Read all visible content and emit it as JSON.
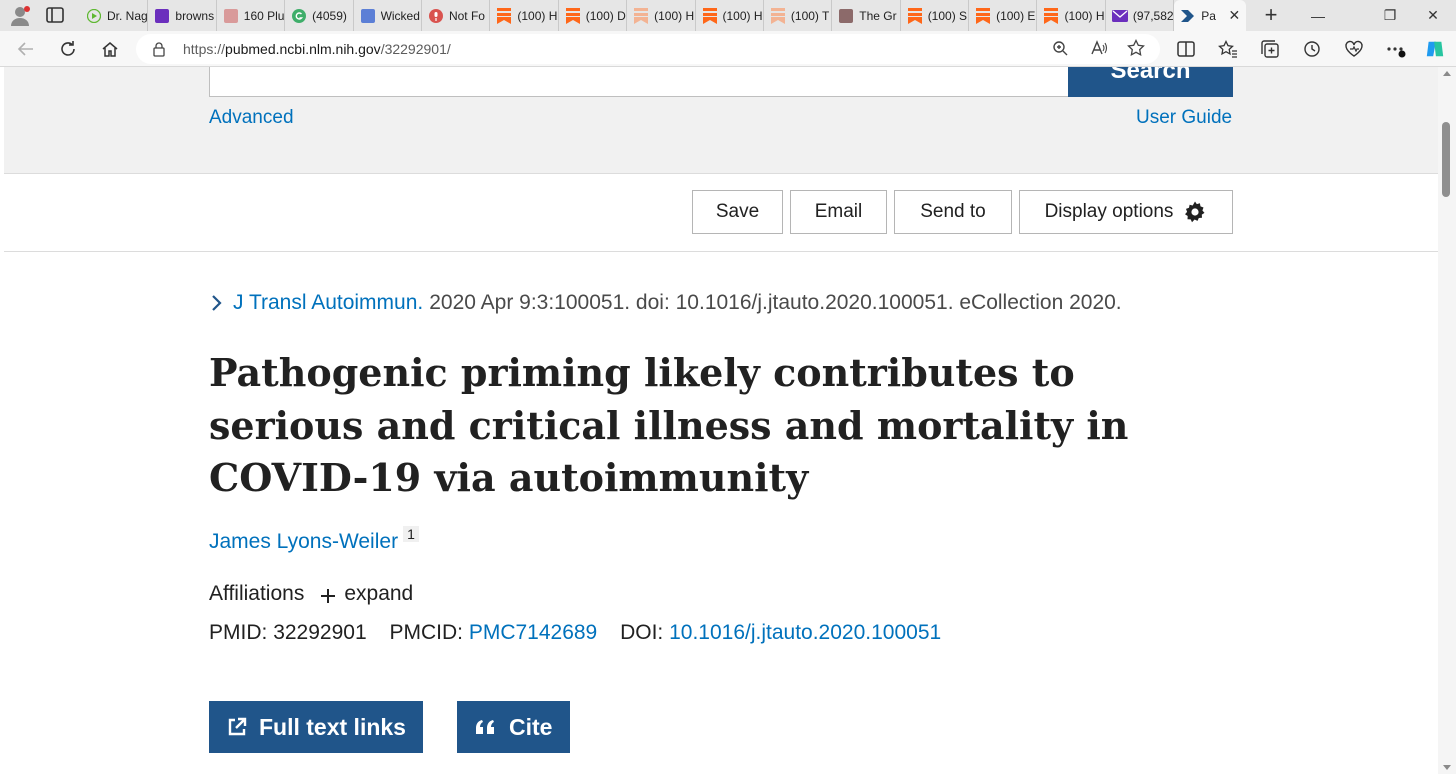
{
  "browser": {
    "tabs": [
      {
        "title": "Dr. Nag",
        "icon": "play-icon",
        "color": "#5fb832"
      },
      {
        "title": "browns",
        "icon": "yahoo-icon",
        "color": "#6b2fbd"
      },
      {
        "title": "160 Plu",
        "icon": "bi-icon",
        "color": "#d99a9a"
      },
      {
        "title": "(4059)",
        "icon": "grammarly-icon",
        "color": "#3fae6a"
      },
      {
        "title": "Wicked",
        "icon": "page-icon",
        "color": "#5c7fd6"
      },
      {
        "title": "Not Fo",
        "icon": "podcast-icon",
        "color": "#d9534f"
      },
      {
        "title": "(100) H",
        "icon": "substack-icon",
        "color": "#ff6719"
      },
      {
        "title": "(100) D",
        "icon": "substack-icon",
        "color": "#ff6719"
      },
      {
        "title": "(100) H",
        "icon": "substack-icon",
        "color": "#f3b393"
      },
      {
        "title": "(100) H",
        "icon": "substack-icon",
        "color": "#ff6719"
      },
      {
        "title": "(100) T",
        "icon": "substack-icon",
        "color": "#f3b393"
      },
      {
        "title": "The Gr",
        "icon": "ds-icon",
        "color": "#8c6a6a"
      },
      {
        "title": "(100) S",
        "icon": "substack-icon",
        "color": "#ff6719"
      },
      {
        "title": "(100) E",
        "icon": "substack-icon",
        "color": "#ff6719"
      },
      {
        "title": "(100) H",
        "icon": "substack-icon",
        "color": "#ff6719"
      },
      {
        "title": "(97,582",
        "icon": "mail-icon",
        "color": "#6b2fbd"
      }
    ],
    "active_tab": {
      "title": "Pa",
      "icon": "pubmed-icon",
      "color": "#20558a"
    },
    "url_prefix": "https://",
    "url_host": "pubmed.ncbi.nlm.nih.gov",
    "url_path": "/32292901/"
  },
  "search": {
    "button_label": "Search",
    "advanced_label": "Advanced",
    "user_guide_label": "User Guide"
  },
  "actions": {
    "save": "Save",
    "email": "Email",
    "send_to": "Send to",
    "display_options": "Display options"
  },
  "article": {
    "journal": "J Transl Autoimmun.",
    "citation": "2020 Apr 9:3:100051. doi: 10.1016/j.jtauto.2020.100051. eCollection 2020.",
    "title": "Pathogenic priming likely contributes to serious and critical illness and mortality in COVID-19 via autoimmunity",
    "author": "James Lyons-Weiler",
    "author_affil_num": "1",
    "affiliations_label": "Affiliations",
    "expand_label": "expand",
    "pmid_label": "PMID:",
    "pmid": "32292901",
    "pmcid_label": "PMCID:",
    "pmcid": "PMC7142689",
    "doi_label": "DOI:",
    "doi": "10.1016/j.jtauto.2020.100051"
  },
  "buttons": {
    "full_text": "Full text links",
    "cite": "Cite"
  },
  "colors": {
    "accent": "#20558a",
    "link": "#0071bc"
  }
}
